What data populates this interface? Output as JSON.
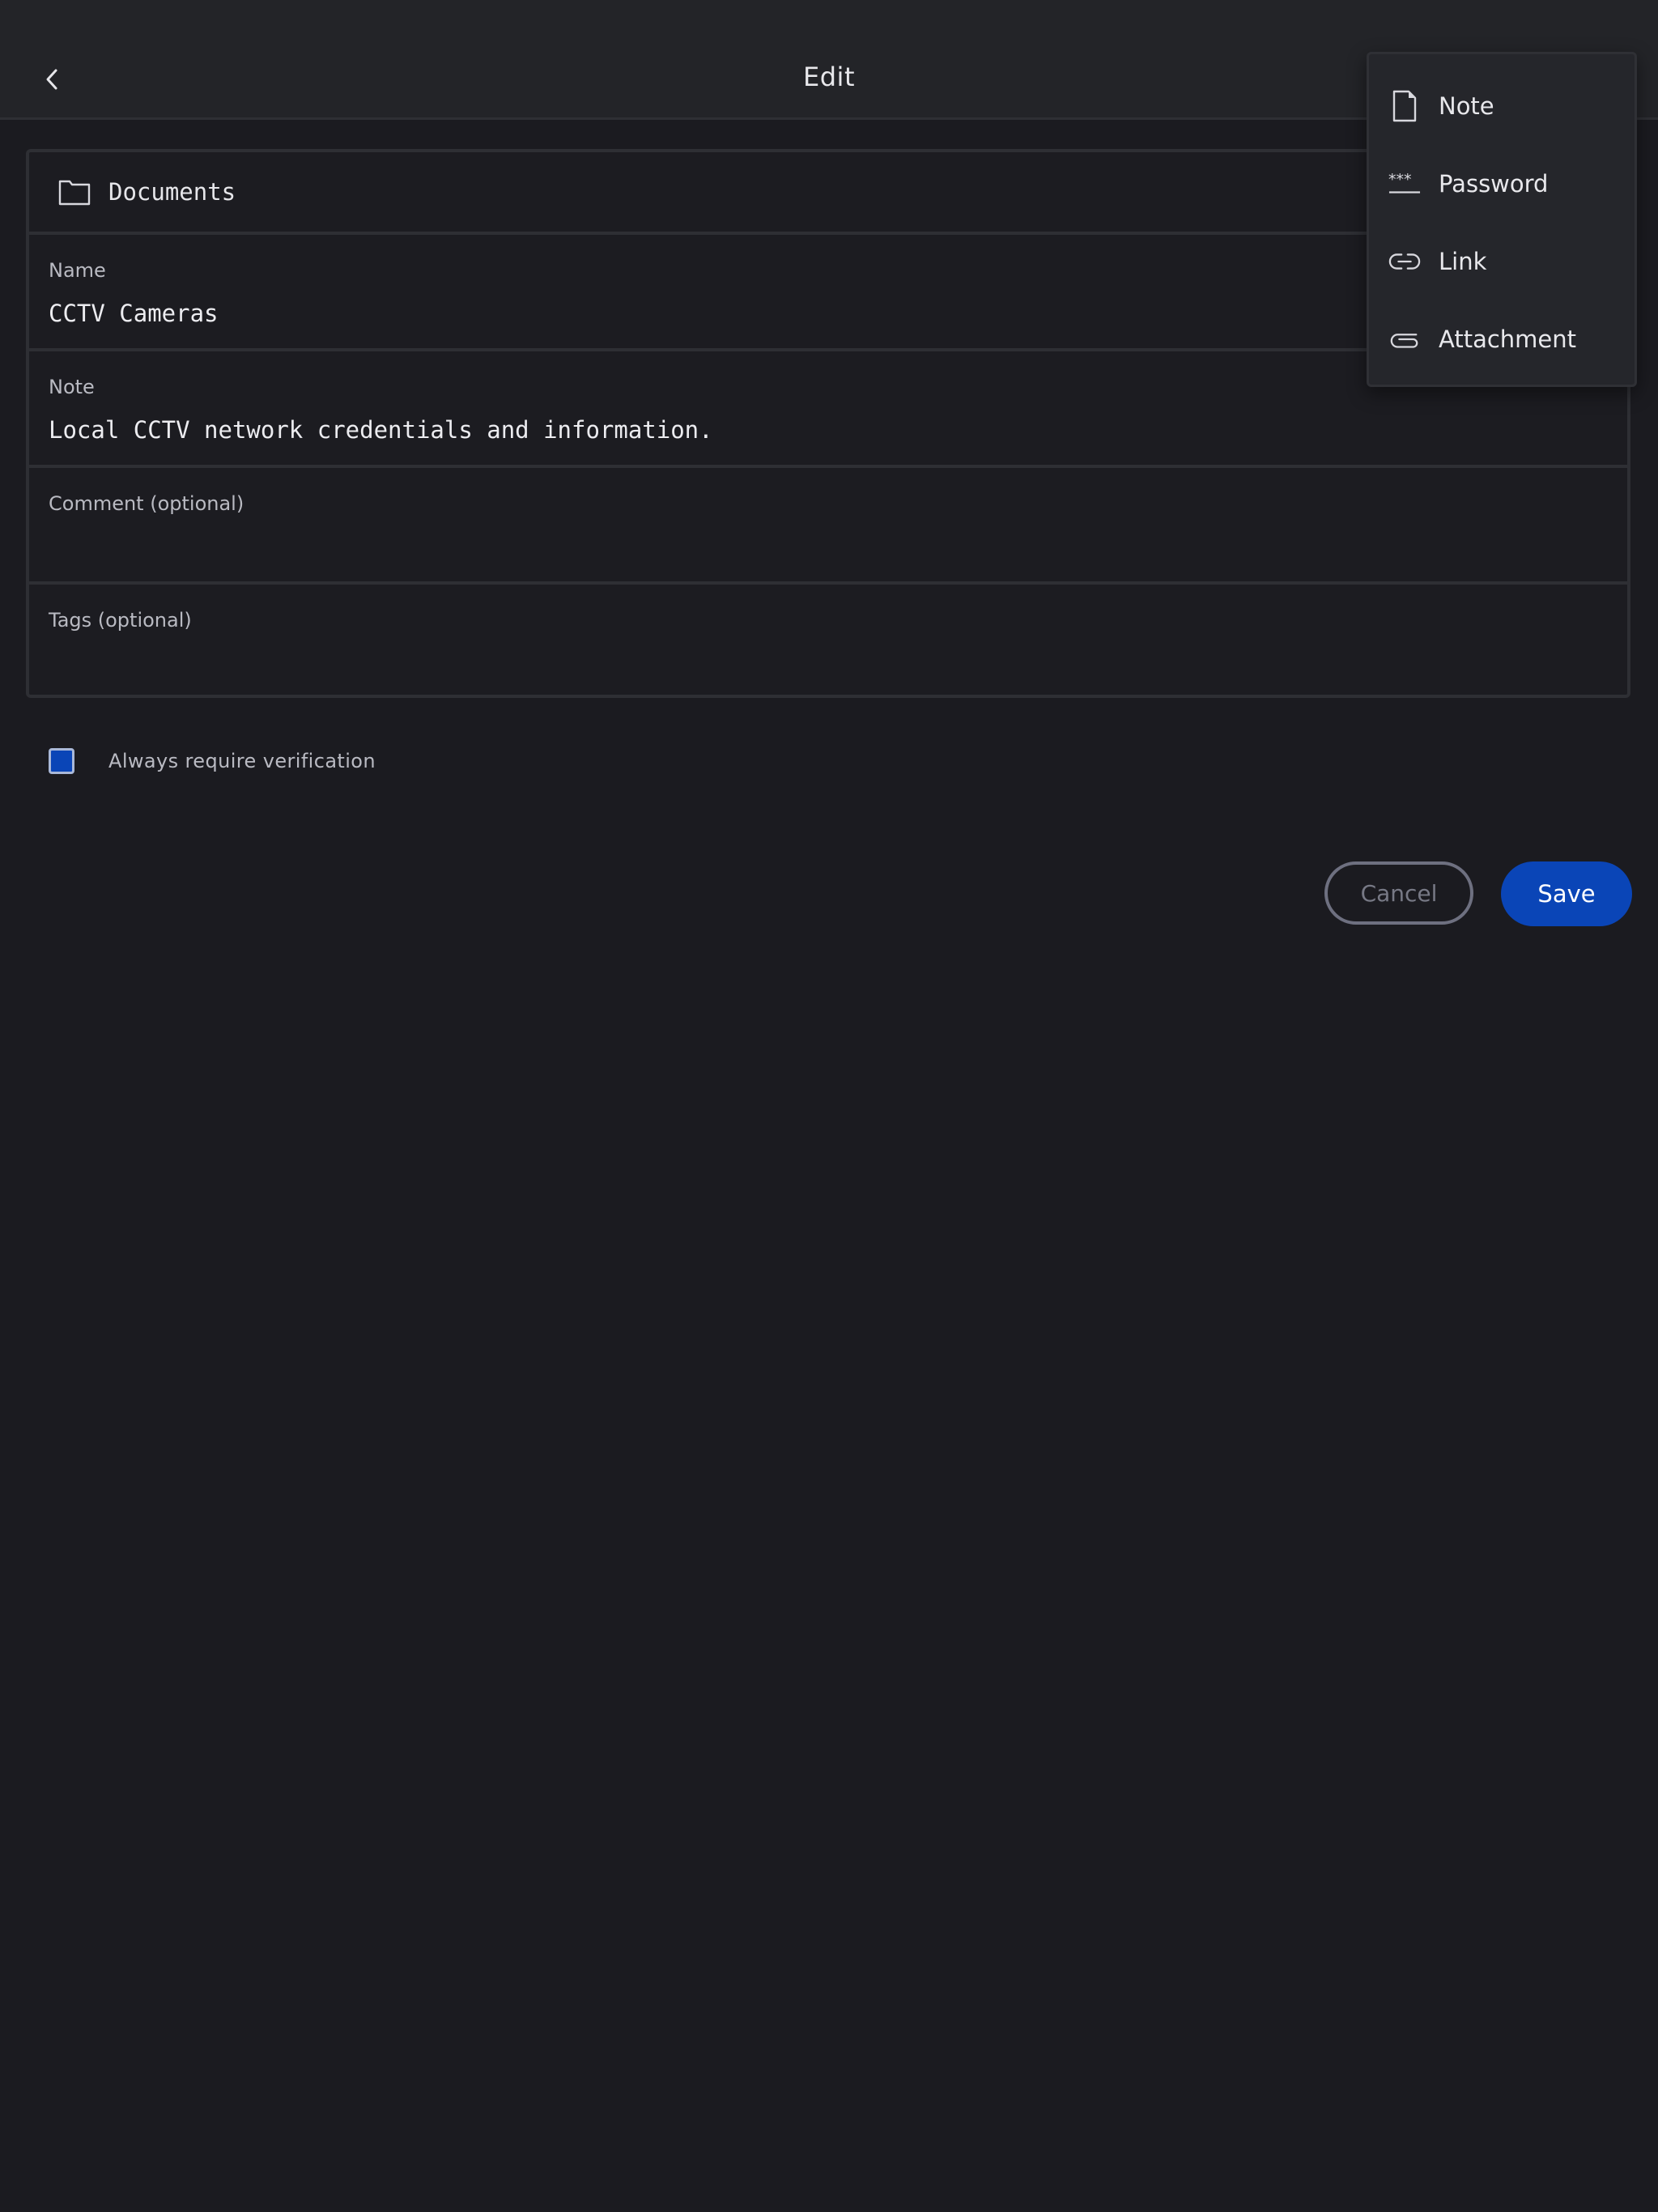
{
  "header": {
    "title": "Edit"
  },
  "form": {
    "folder": "Documents",
    "name": {
      "label": "Name",
      "value": "CCTV Cameras"
    },
    "note": {
      "label": "Note",
      "value": "Local CCTV network credentials and information."
    },
    "comment": {
      "label": "Comment (optional)",
      "value": ""
    },
    "tags": {
      "label": "Tags (optional)",
      "value": ""
    }
  },
  "verification": {
    "label": "Always require verification",
    "checked": true
  },
  "actions": {
    "cancel": "Cancel",
    "save": "Save"
  },
  "menu": {
    "items": [
      {
        "label": "Note",
        "icon": "document-icon"
      },
      {
        "label": "Password",
        "icon": "password-icon"
      },
      {
        "label": "Link",
        "icon": "link-icon"
      },
      {
        "label": "Attachment",
        "icon": "attachment-icon"
      }
    ]
  },
  "colors": {
    "background": "#1b1b20",
    "header": "#232428",
    "accent": "#0a45b7",
    "border": "#2e2f34"
  }
}
